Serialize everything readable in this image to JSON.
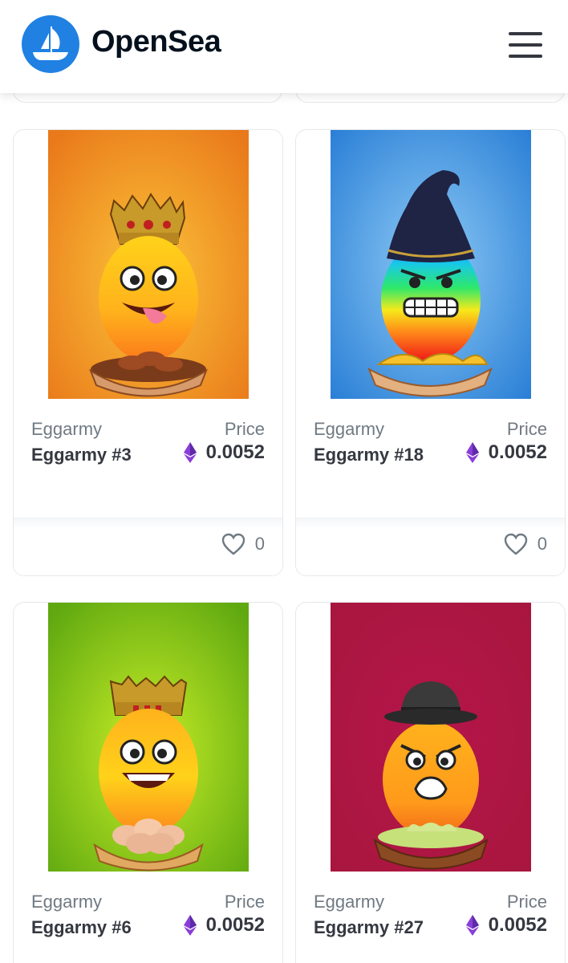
{
  "header": {
    "brand": "OpenSea",
    "logo_icon": "opensea-boat-logo-icon",
    "menu_icon": "hamburger-menu-icon",
    "accent": "#2081e2"
  },
  "cards": [
    {
      "collection": "Eggarmy",
      "name": "Eggarmy #3",
      "price_label": "Price",
      "price": "0.0052",
      "currency_icon": "ethereum-icon",
      "likes": "0",
      "background": "#ee8a1a",
      "accessory": "crown"
    },
    {
      "collection": "Eggarmy",
      "name": "Eggarmy #18",
      "price_label": "Price",
      "price": "0.0052",
      "currency_icon": "ethereum-icon",
      "likes": "0",
      "background": "#3f9de6",
      "accessory": "wizard-hat"
    },
    {
      "collection": "Eggarmy",
      "name": "Eggarmy #6",
      "price_label": "Price",
      "price": "0.0052",
      "currency_icon": "ethereum-icon",
      "likes": "",
      "background": "#7cc317",
      "accessory": "crown"
    },
    {
      "collection": "Eggarmy",
      "name": "Eggarmy #27",
      "price_label": "Price",
      "price": "0.0052",
      "currency_icon": "ethereum-icon",
      "likes": "",
      "background": "#a8163e",
      "accessory": "fedora"
    }
  ]
}
